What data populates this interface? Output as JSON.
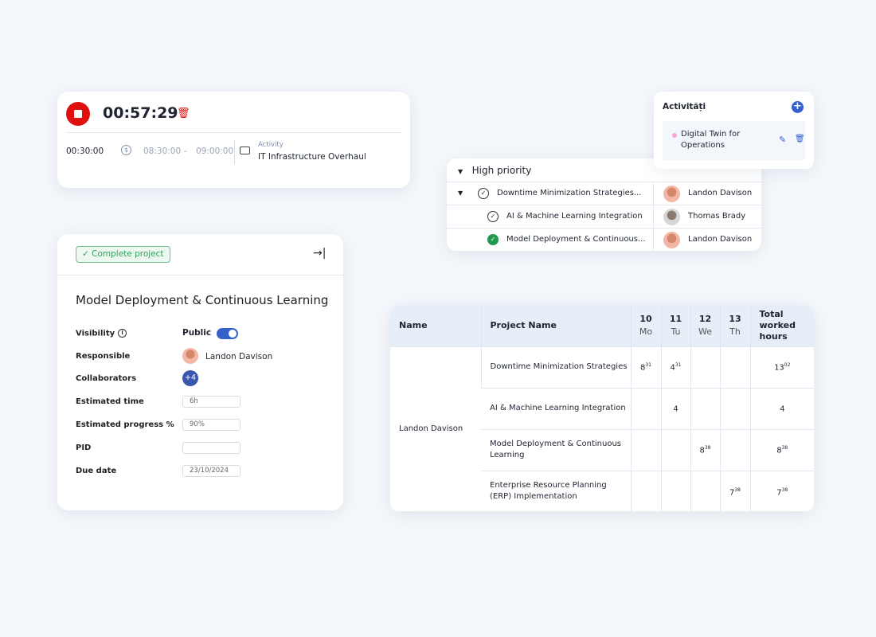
{
  "timer": {
    "elapsed": "00:57:29",
    "duration": "00:30:00",
    "start": "08:30:00",
    "separator": "-",
    "end": "09:00:00",
    "activity_label": "Activity",
    "activity": "IT Infrastructure Overhaul",
    "colors": {
      "stop": "#e01010"
    }
  },
  "project": {
    "complete_label": "Complete project",
    "title": "Model Deployment & Continuous Learning",
    "fields": {
      "visibility_label": "Visibility",
      "visibility_value": "Public",
      "responsible_label": "Responsible",
      "responsible": "Landon Davison",
      "collaborators_label": "Collaborators",
      "collaborators_more": "+4",
      "est_time_label": "Estimated time",
      "est_time": "6h",
      "est_progress_label": "Estimated progress %",
      "est_progress": "90%",
      "pid_label": "PID",
      "pid": "",
      "due_label": "Due date",
      "due": "23/10/2024"
    }
  },
  "priority": {
    "group": "High priority",
    "rows": [
      {
        "task": "Downtime Minimization Strategies...",
        "assignee": "Landon Davison",
        "done": false
      },
      {
        "task": "AI & Machine Learning Integration",
        "assignee": "Thomas Brady",
        "done": false
      },
      {
        "task": "Model Deployment & Continuous...",
        "assignee": "Landon Davison",
        "done": true
      }
    ]
  },
  "activities": {
    "title": "Activități",
    "items": [
      {
        "name": "Digital Twin for Operations",
        "dot_color": "#f7a8d8"
      }
    ]
  },
  "hours": {
    "headers": {
      "name": "Name",
      "project": "Project Name",
      "total": "Total worked hours"
    },
    "days": [
      {
        "num": "10",
        "day": "Mo"
      },
      {
        "num": "11",
        "day": "Tu"
      },
      {
        "num": "12",
        "day": "We"
      },
      {
        "num": "13",
        "day": "Th"
      }
    ],
    "person": "Landon Davison",
    "rows": [
      {
        "project": "Downtime Minimization Strategies",
        "cells": [
          [
            "8",
            "31"
          ],
          [
            "4",
            "31"
          ],
          [
            "",
            ""
          ],
          [
            "",
            ""
          ]
        ],
        "total": [
          "13",
          "02"
        ]
      },
      {
        "project": "AI & Machine Learning Integration",
        "cells": [
          [
            "",
            ""
          ],
          [
            "4",
            ""
          ],
          [
            "",
            ""
          ],
          [
            "",
            ""
          ]
        ],
        "total": [
          "4",
          ""
        ]
      },
      {
        "project": "Model Deployment & Continuous Learning",
        "cells": [
          [
            "",
            ""
          ],
          [
            "",
            ""
          ],
          [
            "8",
            "38"
          ],
          [
            "",
            ""
          ]
        ],
        "total": [
          "8",
          "38"
        ]
      },
      {
        "project": "Enterprise Resource Planning (ERP) Implementation",
        "cells": [
          [
            "",
            ""
          ],
          [
            "",
            ""
          ],
          [
            "",
            ""
          ],
          [
            "7",
            "38"
          ]
        ],
        "total": [
          "7",
          "38"
        ]
      }
    ]
  }
}
